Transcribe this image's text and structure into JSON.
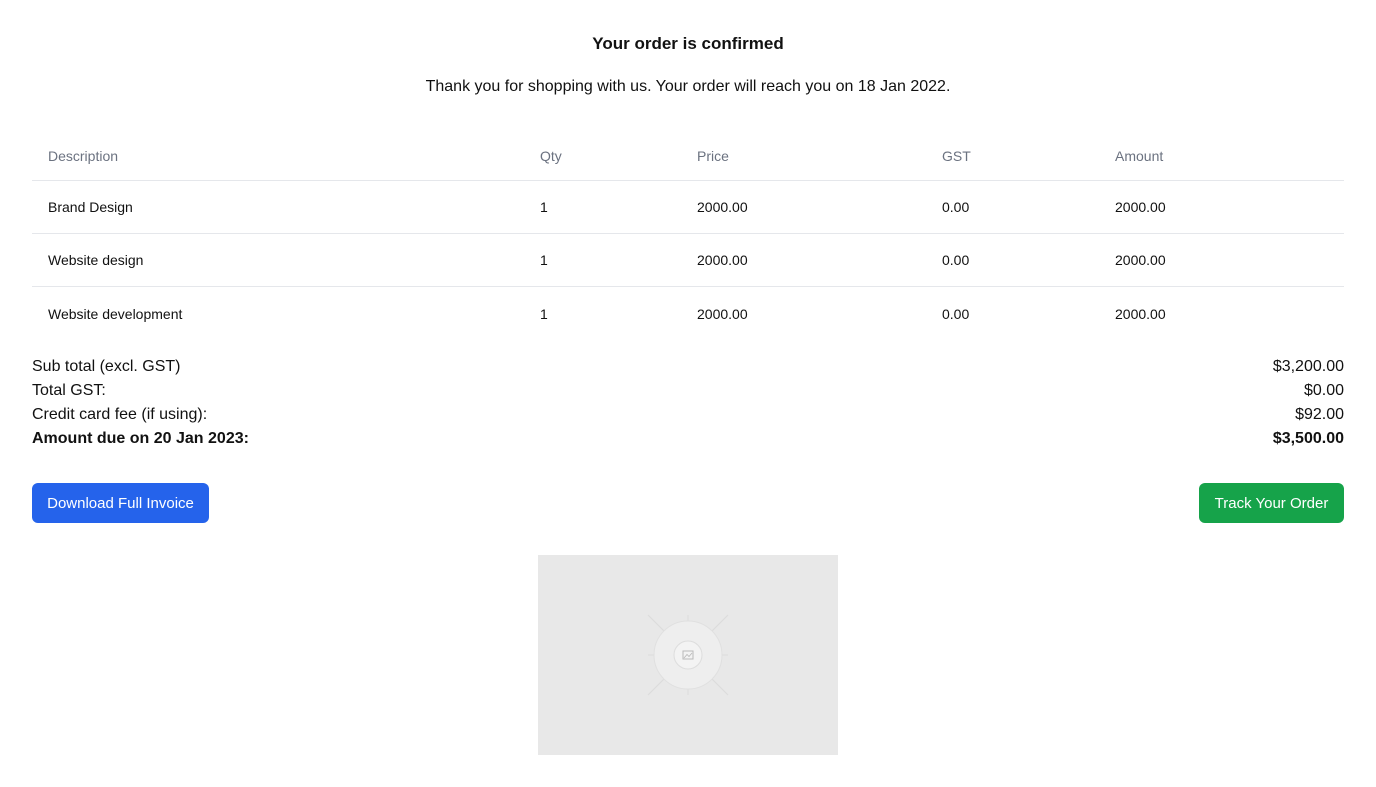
{
  "header": {
    "title": "Your order is confirmed",
    "subtitle": "Thank you for shopping with us. Your order will reach you on 18 Jan 2022."
  },
  "table": {
    "columns": [
      "Description",
      "Qty",
      "Price",
      "GST",
      "Amount"
    ],
    "rows": [
      {
        "description": "Brand Design",
        "qty": "1",
        "price": "2000.00",
        "gst": "0.00",
        "amount": "2000.00"
      },
      {
        "description": "Website design",
        "qty": "1",
        "price": "2000.00",
        "gst": "0.00",
        "amount": "2000.00"
      },
      {
        "description": "Website development",
        "qty": "1",
        "price": "2000.00",
        "gst": "0.00",
        "amount": "2000.00"
      }
    ]
  },
  "totals": {
    "subtotal_label": "Sub total (excl. GST)",
    "subtotal_value": "$3,200.00",
    "gst_label": "Total GST:",
    "gst_value": "$0.00",
    "card_fee_label": "Credit card fee (if using):",
    "card_fee_value": "$92.00",
    "due_label": "Amount due on 20 Jan 2023:",
    "due_value": "$3,500.00"
  },
  "actions": {
    "download_label": "Download Full Invoice",
    "track_label": "Track Your Order"
  },
  "colors": {
    "primary_button": "#2563eb",
    "success_button": "#16a34a",
    "placeholder_bg": "#e8e8e8"
  },
  "image": {
    "icon": "image-placeholder-icon"
  }
}
